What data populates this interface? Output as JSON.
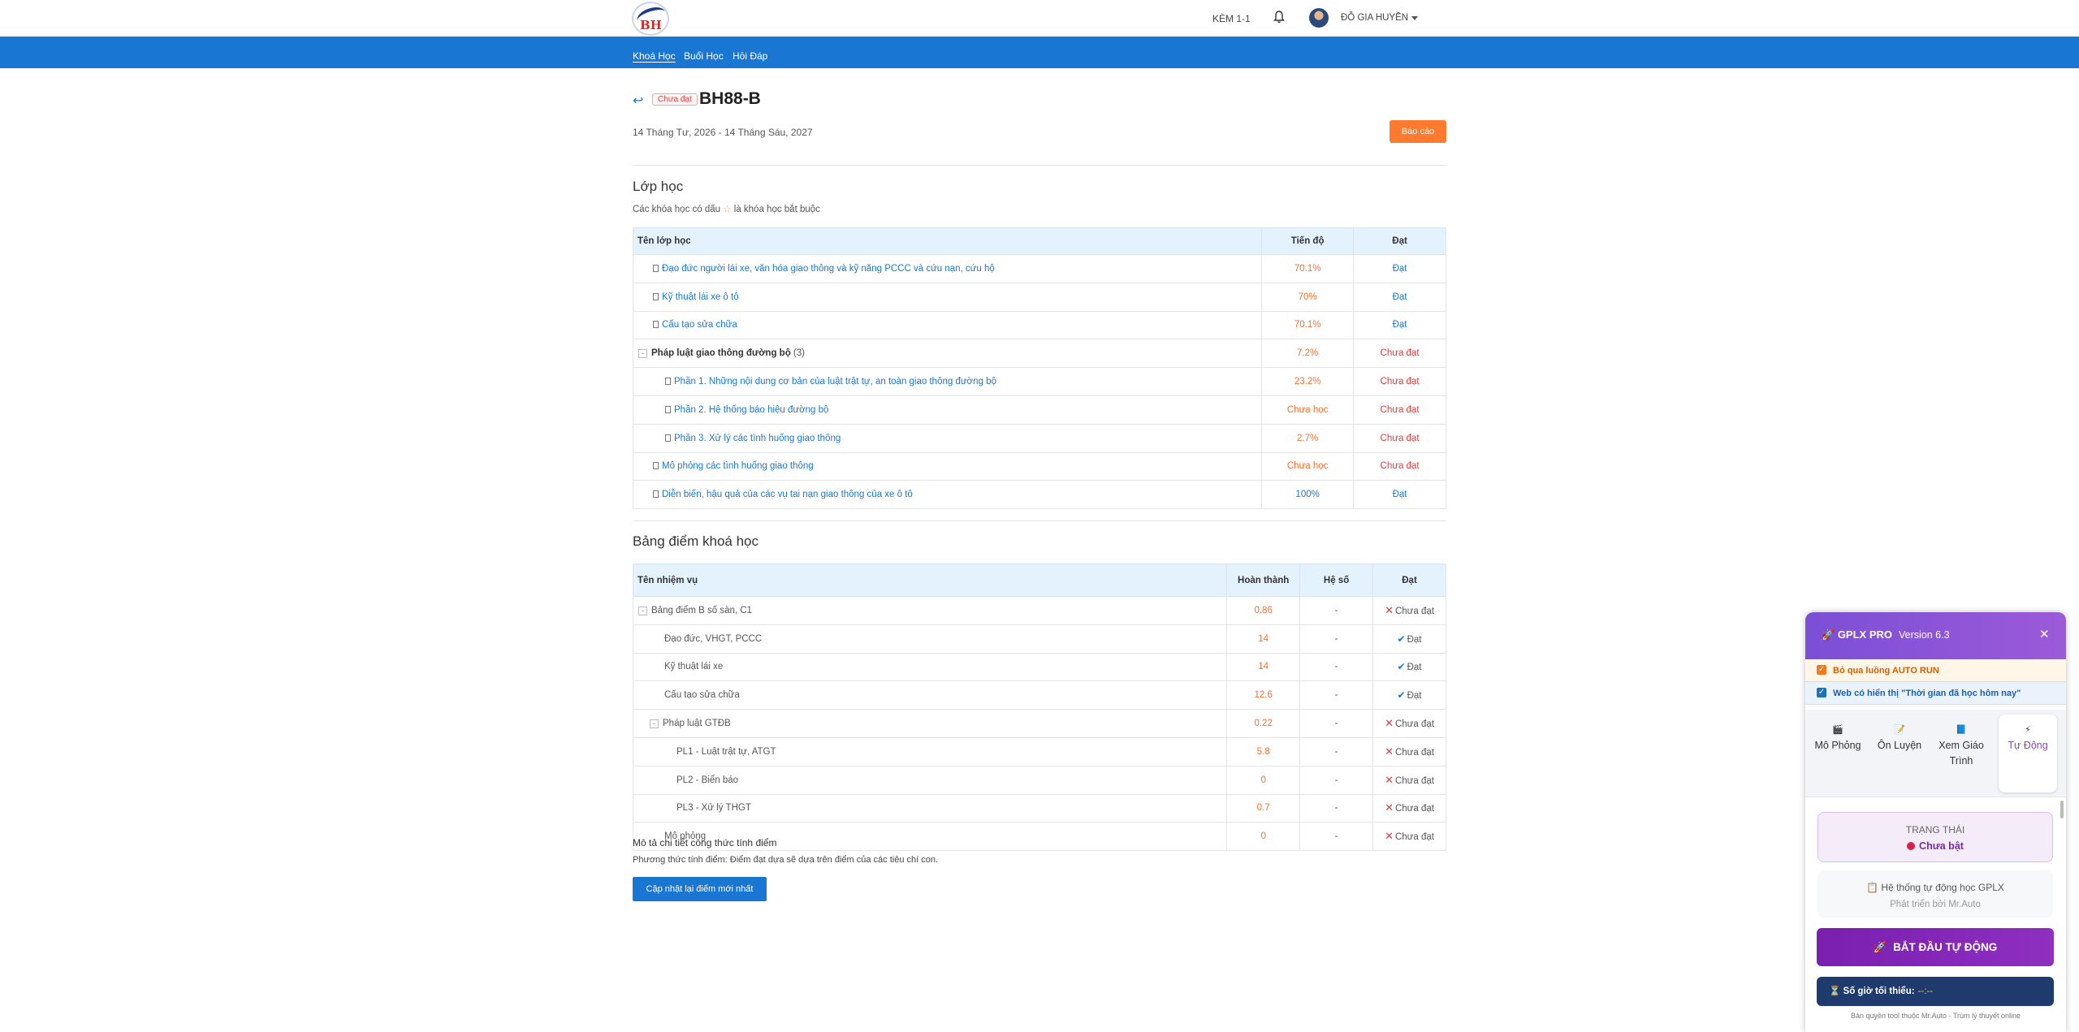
{
  "header": {
    "nav_right": "KÈM 1-1",
    "username": "ĐỖ GIA HUYỀN"
  },
  "navbar": {
    "items": [
      "Khoá Học",
      "Buổi Học",
      "Hỏi Đáp"
    ]
  },
  "course": {
    "status_tag": "Chưa đạt",
    "code": "BH88-B",
    "date_range": "14 Tháng Tư, 2026 - 14 Tháng Sáu, 2027",
    "report_button": "Báo cáo"
  },
  "classes": {
    "title": "Lớp học",
    "note_prefix": "Các khóa học có dấu",
    "note_star": "☆",
    "note_suffix": "là khóa học bắt buộc",
    "columns": [
      "Tên lớp học",
      "Tiến độ",
      "Đạt"
    ],
    "rows": [
      {
        "name": "Đạo đức người lái xe, văn hóa giao thông và kỹ năng PCCC và cứu nạn, cứu hộ",
        "progress": "70.1%",
        "result": "Đạt"
      },
      {
        "name": "Kỹ thuật lái xe ô tô",
        "progress": "70%",
        "result": "Đạt"
      },
      {
        "name": "Cấu tạo sửa chữa",
        "progress": "70.1%",
        "result": "Đạt"
      },
      {
        "name": "Pháp luật giao thông đường bộ",
        "count": "(3)",
        "progress": "7.2%",
        "result": "Chưa đạt"
      },
      {
        "name": "Phần 1. Những nội dung cơ bản của luật trật tự, an toàn giao thông đường bộ",
        "progress": "23.2%",
        "result": "Chưa đạt"
      },
      {
        "name": "Phần 2. Hệ thống báo hiệu đường bộ",
        "progress": "Chưa học",
        "result": "Chưa đạt"
      },
      {
        "name": "Phần 3. Xử lý các tình huống giao thông",
        "progress": "2.7%",
        "result": "Chưa đạt"
      },
      {
        "name": "Mô phỏng các tình huống giao thông",
        "progress": "Chưa học",
        "result": "Chưa đạt"
      },
      {
        "name": "Diễn biến, hậu quả của các vụ tai nạn giao thông của xe ô tô",
        "progress": "100%",
        "result": "Đạt"
      }
    ]
  },
  "scores": {
    "title": "Bảng điểm khoá học",
    "columns": [
      "Tên nhiệm vụ",
      "Hoàn thành",
      "Hệ số",
      "Đạt"
    ],
    "rows": [
      {
        "name": "Bảng điểm B số sàn, C1",
        "done": "0.86",
        "coef": "-",
        "result": "Chưa đạt"
      },
      {
        "name": "Đạo đức, VHGT, PCCC",
        "done": "14",
        "coef": "-",
        "result": "Đạt"
      },
      {
        "name": "Kỹ thuật lái xe",
        "done": "14",
        "coef": "-",
        "result": "Đạt"
      },
      {
        "name": "Cấu tạo sửa chữa",
        "done": "12.6",
        "coef": "-",
        "result": "Đạt"
      },
      {
        "name": "Pháp luật GTĐB",
        "done": "0.22",
        "coef": "-",
        "result": "Chưa đạt"
      },
      {
        "name": "PL1 - Luật trật tự, ATGT",
        "done": "5.8",
        "coef": "-",
        "result": "Chưa đạt"
      },
      {
        "name": "PL2 - Biển báo",
        "done": "0",
        "coef": "-",
        "result": "Chưa đạt"
      },
      {
        "name": "PL3 - Xử lý THGT",
        "done": "0.7",
        "coef": "-",
        "result": "Chưa đạt"
      },
      {
        "name": "Mô phỏng",
        "done": "0",
        "coef": "-",
        "result": "Chưa đạt"
      }
    ],
    "formula_title": "Mô tả chi tiết công thức tính điểm",
    "formula_desc": "Phương thức tính điểm: Điểm đạt dựa sẽ dựa trên điểm của các tiêu chí con.",
    "update_button": "Cập nhật lại điểm mới nhất"
  },
  "panel": {
    "title": "GPLX PRO",
    "version": "Version 6.3",
    "option1": "Bỏ qua luồng AUTO RUN",
    "option2": "Web có hiển thị \"Thời gian đã học hôm nay\"",
    "tabs": [
      "Mô Phỏng",
      "Ôn Luyện",
      "Xem Giáo Trình",
      "Tự Động"
    ],
    "status_label": "TRẠNG THÁI",
    "status_value": "Chưa bật",
    "info_line1": "Hệ thống tự động học GPLX",
    "info_line2": "Phát triển bởi Mr.Auto",
    "start_button": "BẮT ĐẦU TỰ ĐỘNG",
    "min_hours_label": "Số giờ tối thiểu:",
    "min_hours_value": "--:--",
    "copyright": "Bản quyền tool thuộc Mr.Auto - Trùm lý thuyết online"
  },
  "colors": {
    "nav_blue": "#1976d2",
    "report_orange": "#ff7a2f",
    "pass_blue": "#1976d2",
    "fail_red": "#e53935",
    "progress_orange": "#ff6d2e",
    "panel_purple": "#7b4fd6"
  }
}
